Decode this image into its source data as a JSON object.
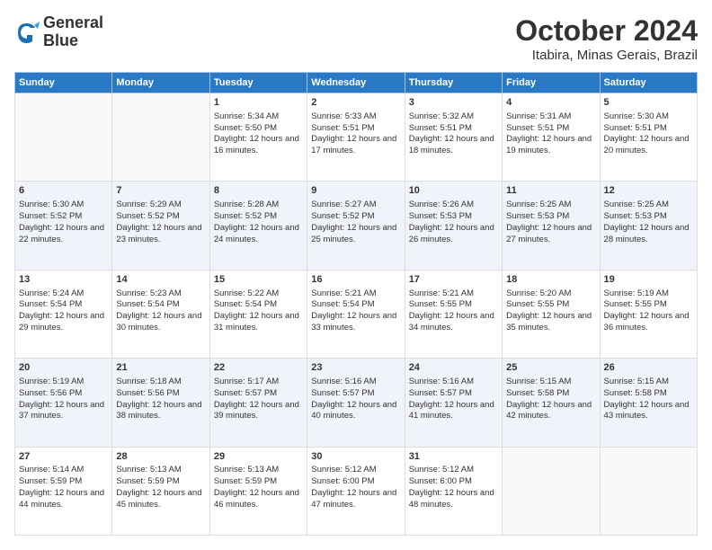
{
  "logo": {
    "line1": "General",
    "line2": "Blue"
  },
  "title": "October 2024",
  "location": "Itabira, Minas Gerais, Brazil",
  "days_of_week": [
    "Sunday",
    "Monday",
    "Tuesday",
    "Wednesday",
    "Thursday",
    "Friday",
    "Saturday"
  ],
  "weeks": [
    [
      {
        "day": "",
        "sunrise": "",
        "sunset": "",
        "daylight": ""
      },
      {
        "day": "",
        "sunrise": "",
        "sunset": "",
        "daylight": ""
      },
      {
        "day": "1",
        "sunrise": "Sunrise: 5:34 AM",
        "sunset": "Sunset: 5:50 PM",
        "daylight": "Daylight: 12 hours and 16 minutes."
      },
      {
        "day": "2",
        "sunrise": "Sunrise: 5:33 AM",
        "sunset": "Sunset: 5:51 PM",
        "daylight": "Daylight: 12 hours and 17 minutes."
      },
      {
        "day": "3",
        "sunrise": "Sunrise: 5:32 AM",
        "sunset": "Sunset: 5:51 PM",
        "daylight": "Daylight: 12 hours and 18 minutes."
      },
      {
        "day": "4",
        "sunrise": "Sunrise: 5:31 AM",
        "sunset": "Sunset: 5:51 PM",
        "daylight": "Daylight: 12 hours and 19 minutes."
      },
      {
        "day": "5",
        "sunrise": "Sunrise: 5:30 AM",
        "sunset": "Sunset: 5:51 PM",
        "daylight": "Daylight: 12 hours and 20 minutes."
      }
    ],
    [
      {
        "day": "6",
        "sunrise": "Sunrise: 5:30 AM",
        "sunset": "Sunset: 5:52 PM",
        "daylight": "Daylight: 12 hours and 22 minutes."
      },
      {
        "day": "7",
        "sunrise": "Sunrise: 5:29 AM",
        "sunset": "Sunset: 5:52 PM",
        "daylight": "Daylight: 12 hours and 23 minutes."
      },
      {
        "day": "8",
        "sunrise": "Sunrise: 5:28 AM",
        "sunset": "Sunset: 5:52 PM",
        "daylight": "Daylight: 12 hours and 24 minutes."
      },
      {
        "day": "9",
        "sunrise": "Sunrise: 5:27 AM",
        "sunset": "Sunset: 5:52 PM",
        "daylight": "Daylight: 12 hours and 25 minutes."
      },
      {
        "day": "10",
        "sunrise": "Sunrise: 5:26 AM",
        "sunset": "Sunset: 5:53 PM",
        "daylight": "Daylight: 12 hours and 26 minutes."
      },
      {
        "day": "11",
        "sunrise": "Sunrise: 5:25 AM",
        "sunset": "Sunset: 5:53 PM",
        "daylight": "Daylight: 12 hours and 27 minutes."
      },
      {
        "day": "12",
        "sunrise": "Sunrise: 5:25 AM",
        "sunset": "Sunset: 5:53 PM",
        "daylight": "Daylight: 12 hours and 28 minutes."
      }
    ],
    [
      {
        "day": "13",
        "sunrise": "Sunrise: 5:24 AM",
        "sunset": "Sunset: 5:54 PM",
        "daylight": "Daylight: 12 hours and 29 minutes."
      },
      {
        "day": "14",
        "sunrise": "Sunrise: 5:23 AM",
        "sunset": "Sunset: 5:54 PM",
        "daylight": "Daylight: 12 hours and 30 minutes."
      },
      {
        "day": "15",
        "sunrise": "Sunrise: 5:22 AM",
        "sunset": "Sunset: 5:54 PM",
        "daylight": "Daylight: 12 hours and 31 minutes."
      },
      {
        "day": "16",
        "sunrise": "Sunrise: 5:21 AM",
        "sunset": "Sunset: 5:54 PM",
        "daylight": "Daylight: 12 hours and 33 minutes."
      },
      {
        "day": "17",
        "sunrise": "Sunrise: 5:21 AM",
        "sunset": "Sunset: 5:55 PM",
        "daylight": "Daylight: 12 hours and 34 minutes."
      },
      {
        "day": "18",
        "sunrise": "Sunrise: 5:20 AM",
        "sunset": "Sunset: 5:55 PM",
        "daylight": "Daylight: 12 hours and 35 minutes."
      },
      {
        "day": "19",
        "sunrise": "Sunrise: 5:19 AM",
        "sunset": "Sunset: 5:55 PM",
        "daylight": "Daylight: 12 hours and 36 minutes."
      }
    ],
    [
      {
        "day": "20",
        "sunrise": "Sunrise: 5:19 AM",
        "sunset": "Sunset: 5:56 PM",
        "daylight": "Daylight: 12 hours and 37 minutes."
      },
      {
        "day": "21",
        "sunrise": "Sunrise: 5:18 AM",
        "sunset": "Sunset: 5:56 PM",
        "daylight": "Daylight: 12 hours and 38 minutes."
      },
      {
        "day": "22",
        "sunrise": "Sunrise: 5:17 AM",
        "sunset": "Sunset: 5:57 PM",
        "daylight": "Daylight: 12 hours and 39 minutes."
      },
      {
        "day": "23",
        "sunrise": "Sunrise: 5:16 AM",
        "sunset": "Sunset: 5:57 PM",
        "daylight": "Daylight: 12 hours and 40 minutes."
      },
      {
        "day": "24",
        "sunrise": "Sunrise: 5:16 AM",
        "sunset": "Sunset: 5:57 PM",
        "daylight": "Daylight: 12 hours and 41 minutes."
      },
      {
        "day": "25",
        "sunrise": "Sunrise: 5:15 AM",
        "sunset": "Sunset: 5:58 PM",
        "daylight": "Daylight: 12 hours and 42 minutes."
      },
      {
        "day": "26",
        "sunrise": "Sunrise: 5:15 AM",
        "sunset": "Sunset: 5:58 PM",
        "daylight": "Daylight: 12 hours and 43 minutes."
      }
    ],
    [
      {
        "day": "27",
        "sunrise": "Sunrise: 5:14 AM",
        "sunset": "Sunset: 5:59 PM",
        "daylight": "Daylight: 12 hours and 44 minutes."
      },
      {
        "day": "28",
        "sunrise": "Sunrise: 5:13 AM",
        "sunset": "Sunset: 5:59 PM",
        "daylight": "Daylight: 12 hours and 45 minutes."
      },
      {
        "day": "29",
        "sunrise": "Sunrise: 5:13 AM",
        "sunset": "Sunset: 5:59 PM",
        "daylight": "Daylight: 12 hours and 46 minutes."
      },
      {
        "day": "30",
        "sunrise": "Sunrise: 5:12 AM",
        "sunset": "Sunset: 6:00 PM",
        "daylight": "Daylight: 12 hours and 47 minutes."
      },
      {
        "day": "31",
        "sunrise": "Sunrise: 5:12 AM",
        "sunset": "Sunset: 6:00 PM",
        "daylight": "Daylight: 12 hours and 48 minutes."
      },
      {
        "day": "",
        "sunrise": "",
        "sunset": "",
        "daylight": ""
      },
      {
        "day": "",
        "sunrise": "",
        "sunset": "",
        "daylight": ""
      }
    ]
  ]
}
